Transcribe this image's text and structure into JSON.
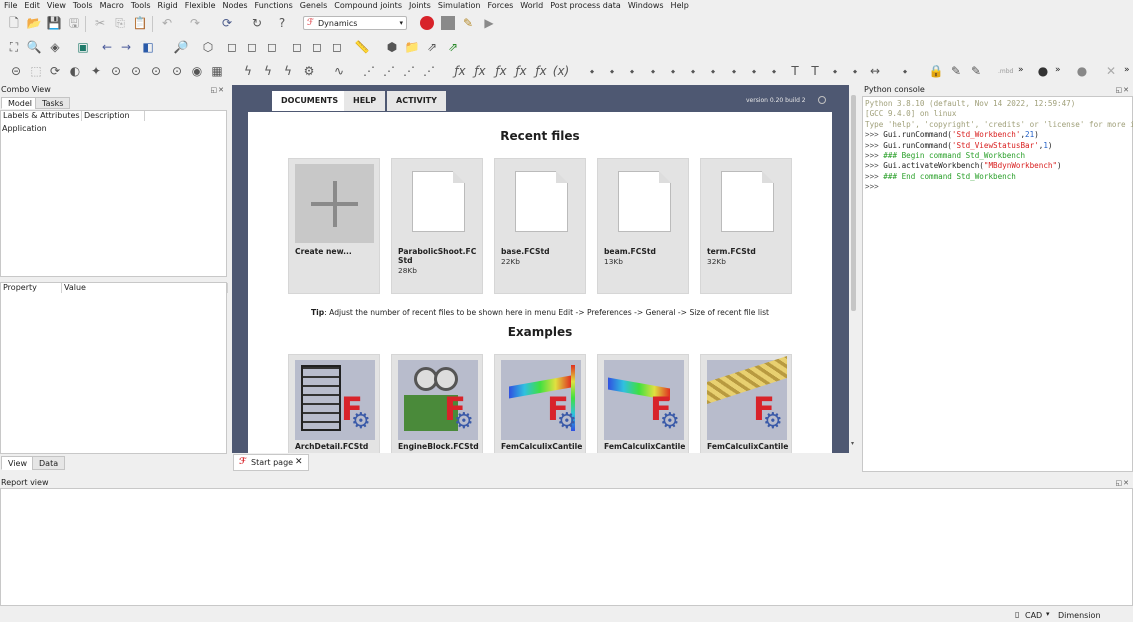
{
  "menu": [
    "File",
    "Edit",
    "View",
    "Tools",
    "Macro",
    "Tools",
    "Rigid",
    "Flexible",
    "Nodes",
    "Functions",
    "Genels",
    "Compound joints",
    "Joints",
    "Simulation",
    "Forces",
    "World",
    "Post process data",
    "Windows",
    "Help"
  ],
  "workbench": {
    "selected": "Dynamics",
    "icon": "dynamics-workbench-icon"
  },
  "toolbar_overflow": "»",
  "mbd_label": ".mbd",
  "combo_view": {
    "title": "Combo View",
    "tabs": [
      "Model",
      "Tasks"
    ],
    "tree_headers": [
      "Labels & Attributes",
      "Description"
    ],
    "tree_items": [
      "Application"
    ],
    "prop_headers": [
      "Property",
      "Value"
    ],
    "bottom_tabs": [
      "View",
      "Data"
    ]
  },
  "start_page": {
    "tabs": [
      "DOCUMENTS",
      "HELP",
      "ACTIVITY"
    ],
    "version": "version 0.20 build 2",
    "recent_title": "Recent files",
    "recent": [
      {
        "title": "Create new...",
        "size": ""
      },
      {
        "title": "ParabolicShoot.FCStd",
        "size": "28Kb"
      },
      {
        "title": "base.FCStd",
        "size": "22Kb"
      },
      {
        "title": "beam.FCStd",
        "size": "13Kb"
      },
      {
        "title": "term.FCStd",
        "size": "32Kb"
      }
    ],
    "tip_label": "Tip",
    "tip_text": ": Adjust the number of recent files to be shown here in menu Edit -> Preferences -> General -> Size of recent file list",
    "examples_title": "Examples",
    "examples": [
      "ArchDetail.FCStd",
      "EngineBlock.FCStd",
      "FemCalculixCantile",
      "FemCalculixCantile",
      "FemCalculixCantile"
    ]
  },
  "doc_tab": {
    "label": "Start page"
  },
  "python_console": {
    "title": "Python console",
    "lines": [
      {
        "segments": [
          {
            "t": "Python 3.8.10 (default, Nov 14 2022, 12:59:47)",
            "c": "#a0a07a"
          }
        ]
      },
      {
        "segments": [
          {
            "t": "[GCC 9.4.0] on linux",
            "c": "#a0a07a"
          }
        ]
      },
      {
        "segments": [
          {
            "t": "Type 'help', 'copyright', 'credits' or 'license' for more information.",
            "c": "#a0a07a"
          }
        ]
      },
      {
        "segments": [
          {
            "t": ">>> ",
            "c": "#555555"
          },
          {
            "t": "Gui.runCommand(",
            "c": "#1e1e1e"
          },
          {
            "t": "'Std_Workbench'",
            "c": "#d92020"
          },
          {
            "t": ",",
            "c": "#1e1e1e"
          },
          {
            "t": "21",
            "c": "#2060c8"
          },
          {
            "t": ")",
            "c": "#1e1e1e"
          }
        ]
      },
      {
        "segments": [
          {
            "t": ">>> ",
            "c": "#555555"
          },
          {
            "t": "Gui.runCommand(",
            "c": "#1e1e1e"
          },
          {
            "t": "'Std_ViewStatusBar'",
            "c": "#d92020"
          },
          {
            "t": ",",
            "c": "#1e1e1e"
          },
          {
            "t": "1",
            "c": "#2060c8"
          },
          {
            "t": ")",
            "c": "#1e1e1e"
          }
        ]
      },
      {
        "segments": [
          {
            "t": ">>> ",
            "c": "#555555"
          },
          {
            "t": "### Begin command Std_Workbench",
            "c": "#2aa02a"
          }
        ]
      },
      {
        "segments": [
          {
            "t": ">>> ",
            "c": "#555555"
          },
          {
            "t": "Gui.activateWorkbench(",
            "c": "#1e1e1e"
          },
          {
            "t": "\"MBdynWorkbench\"",
            "c": "#d92020"
          },
          {
            "t": ")",
            "c": "#1e1e1e"
          }
        ]
      },
      {
        "segments": [
          {
            "t": ">>> ",
            "c": "#555555"
          },
          {
            "t": "### End command Std_Workbench",
            "c": "#2aa02a"
          }
        ]
      },
      {
        "segments": [
          {
            "t": ">>>",
            "c": "#555555"
          }
        ]
      }
    ]
  },
  "report_view": {
    "title": "Report view"
  },
  "status_bar": {
    "nav_style": "CAD",
    "units": "Dimension"
  },
  "colors": {
    "accent_red": "#d8232a",
    "startpage_bg": "#4e5872",
    "record": "#d8232a"
  }
}
